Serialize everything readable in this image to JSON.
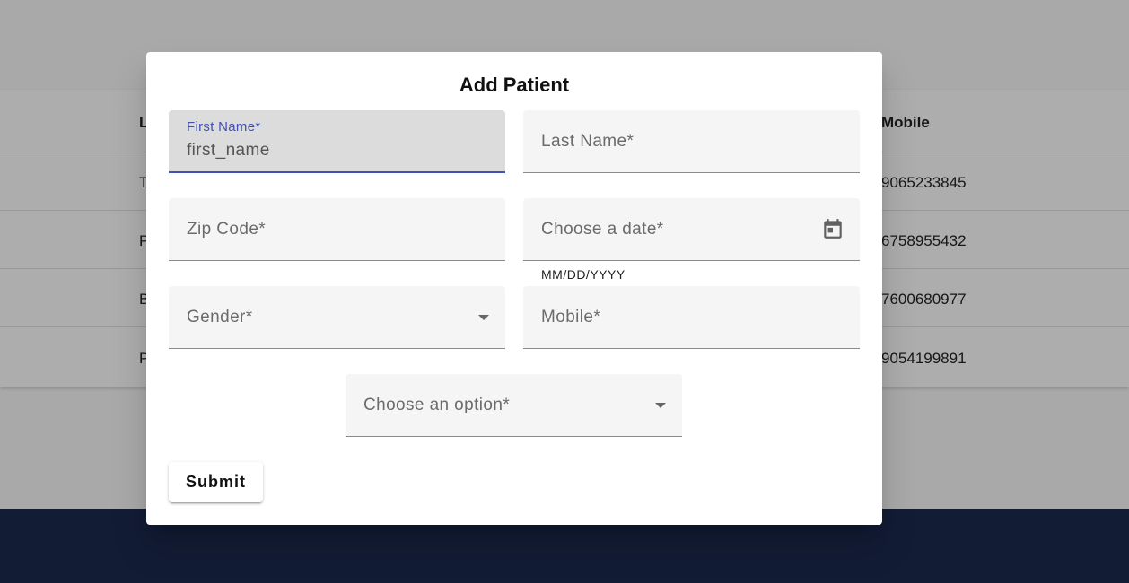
{
  "background": {
    "table": {
      "header": {
        "col_l_initial": "L",
        "mobile": "Mobile"
      },
      "rows": [
        {
          "initial": "T",
          "mobile": "9065233845"
        },
        {
          "initial": "P",
          "mobile": "6758955432"
        },
        {
          "initial": "B",
          "mobile": "7600680977"
        },
        {
          "initial": "P",
          "mobile": "9054199891"
        }
      ]
    }
  },
  "dialog": {
    "title": "Add Patient",
    "fields": {
      "first_name": {
        "label": "First Name*",
        "value": "first_name"
      },
      "last_name": {
        "label": "Last Name*"
      },
      "zip_code": {
        "label": "Zip Code*"
      },
      "date": {
        "label": "Choose a date*",
        "hint": "MM/DD/YYYY",
        "icon": "calendar-icon"
      },
      "gender": {
        "label": "Gender*",
        "icon": "dropdown-arrow-icon"
      },
      "mobile": {
        "label": "Mobile*"
      },
      "option": {
        "label": "Choose an option*",
        "icon": "dropdown-arrow-icon"
      }
    },
    "submit_label": "Submit"
  },
  "colors": {
    "accent": "#3f51b5",
    "footer": "#1b2a4e",
    "field_bg": "#f5f5f5"
  }
}
